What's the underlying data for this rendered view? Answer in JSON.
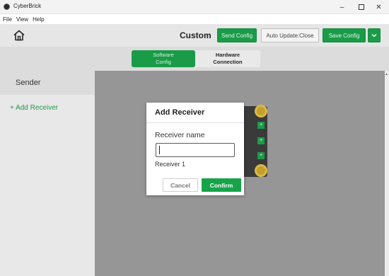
{
  "window": {
    "title": "CyberBrick",
    "minimize_glyph": "–",
    "close_glyph": "✕"
  },
  "menu": {
    "items": [
      "File",
      "View",
      "Help"
    ]
  },
  "header": {
    "title": "Custom",
    "send_config": "Send Config",
    "auto_update": "Auto Update:Close",
    "save_config": "Save Config",
    "dropdown_glyph": "⌄"
  },
  "tabs": {
    "software": "Software\nConfig",
    "hardware": "Hardware\nConnection",
    "active": "software"
  },
  "sidebar": {
    "sender": "Sender",
    "add_receiver": "+ Add Receiver"
  },
  "dialog": {
    "title": "Add Receiver",
    "field_label": "Receiver name",
    "field_value": "",
    "field_placeholder": "",
    "suggestion": "Receiver 1",
    "cancel": "Cancel",
    "confirm": "Confirm"
  },
  "colors": {
    "accent_green": "#1a9b48",
    "confirm_green": "#16a34a",
    "canvas_gray": "#969696"
  },
  "icons": {
    "home": "home-icon",
    "app": "app-logo-icon"
  }
}
